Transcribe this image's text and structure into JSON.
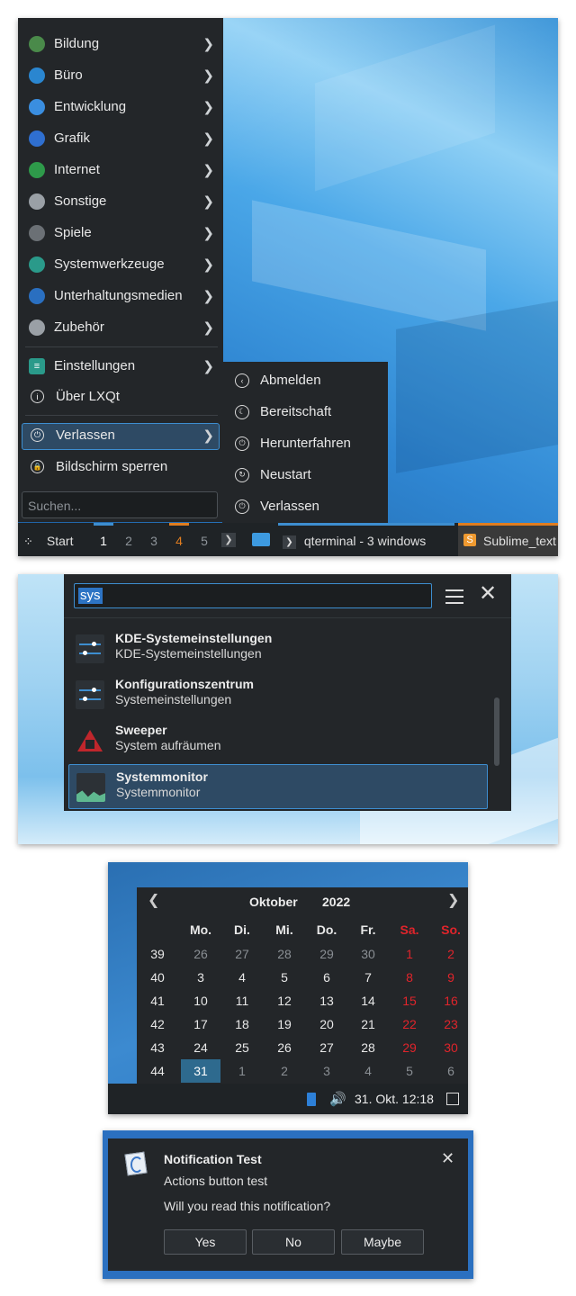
{
  "start_menu": {
    "categories": [
      {
        "label": "Bildung",
        "icon": "education-icon",
        "color": "#4a8a4a"
      },
      {
        "label": "Büro",
        "icon": "office-icon",
        "color": "#2a86d0"
      },
      {
        "label": "Entwicklung",
        "icon": "development-icon",
        "color": "#3a8ee0"
      },
      {
        "label": "Grafik",
        "icon": "graphics-icon",
        "color": "#2f6fd0"
      },
      {
        "label": "Internet",
        "icon": "internet-globe-icon",
        "color": "#2e9a4a"
      },
      {
        "label": "Sonstige",
        "icon": "other-icon",
        "color": "#9aa0a6"
      },
      {
        "label": "Spiele",
        "icon": "games-gamepad-icon",
        "color": "#6b7075"
      },
      {
        "label": "Systemwerkzeuge",
        "icon": "system-tools-icon",
        "color": "#2a9a8a"
      },
      {
        "label": "Unterhaltungsmedien",
        "icon": "multimedia-icon",
        "color": "#2a6fc0"
      },
      {
        "label": "Zubehör",
        "icon": "accessories-icon",
        "color": "#9aa0a6"
      }
    ],
    "settings_label": "Einstellungen",
    "about_label": "Über LXQt",
    "leave_label": "Verlassen",
    "lock_label": "Bildschirm sperren",
    "search_placeholder": "Suchen...",
    "leave_submenu": [
      "Abmelden",
      "Bereitschaft",
      "Herunterfahren",
      "Neustart",
      "Verlassen"
    ]
  },
  "taskbar": {
    "start_label": "Start",
    "workspaces": [
      "1",
      "2",
      "3",
      "4",
      "5"
    ],
    "windows": [
      {
        "label": "qterminal - 3 windows"
      },
      {
        "label": "Sublime_text"
      }
    ]
  },
  "search_dialog": {
    "query": "sys",
    "results": [
      {
        "title": "KDE-Systemeinstellungen",
        "subtitle": "KDE-Systemeinstellungen",
        "icon": "settings-sliders-icon"
      },
      {
        "title": "Konfigurationszentrum",
        "subtitle": "Systemeinstellungen",
        "icon": "settings-sliders-icon"
      },
      {
        "title": "Sweeper",
        "subtitle": "System aufräumen",
        "icon": "sweeper-icon"
      },
      {
        "title": "Systemmonitor",
        "subtitle": "Systemmonitor",
        "icon": "system-monitor-icon"
      }
    ]
  },
  "calendar": {
    "month": "Oktober",
    "year": "2022",
    "weekday_headers": [
      "Mo.",
      "Di.",
      "Mi.",
      "Do.",
      "Fr.",
      "Sa.",
      "So."
    ],
    "weeks": [
      {
        "wk": "39",
        "days": [
          "26",
          "27",
          "28",
          "29",
          "30",
          "1",
          "2"
        ]
      },
      {
        "wk": "40",
        "days": [
          "3",
          "4",
          "5",
          "6",
          "7",
          "8",
          "9"
        ]
      },
      {
        "wk": "41",
        "days": [
          "10",
          "11",
          "12",
          "13",
          "14",
          "15",
          "16"
        ]
      },
      {
        "wk": "42",
        "days": [
          "17",
          "18",
          "19",
          "20",
          "21",
          "22",
          "23"
        ]
      },
      {
        "wk": "43",
        "days": [
          "24",
          "25",
          "26",
          "27",
          "28",
          "29",
          "30"
        ]
      },
      {
        "wk": "44",
        "days": [
          "31",
          "1",
          "2",
          "3",
          "4",
          "5",
          "6"
        ]
      }
    ],
    "clock": "31. Okt. 12:18"
  },
  "notification": {
    "title": "Notification Test",
    "subtitle": "Actions button test",
    "body": "Will you read this notification?",
    "buttons": [
      "Yes",
      "No",
      "Maybe"
    ]
  },
  "colors": {
    "accent": "#3d8ed0",
    "selection": "#2e4a64",
    "weekend": "#e0242b",
    "today": "#2e6a8e"
  }
}
